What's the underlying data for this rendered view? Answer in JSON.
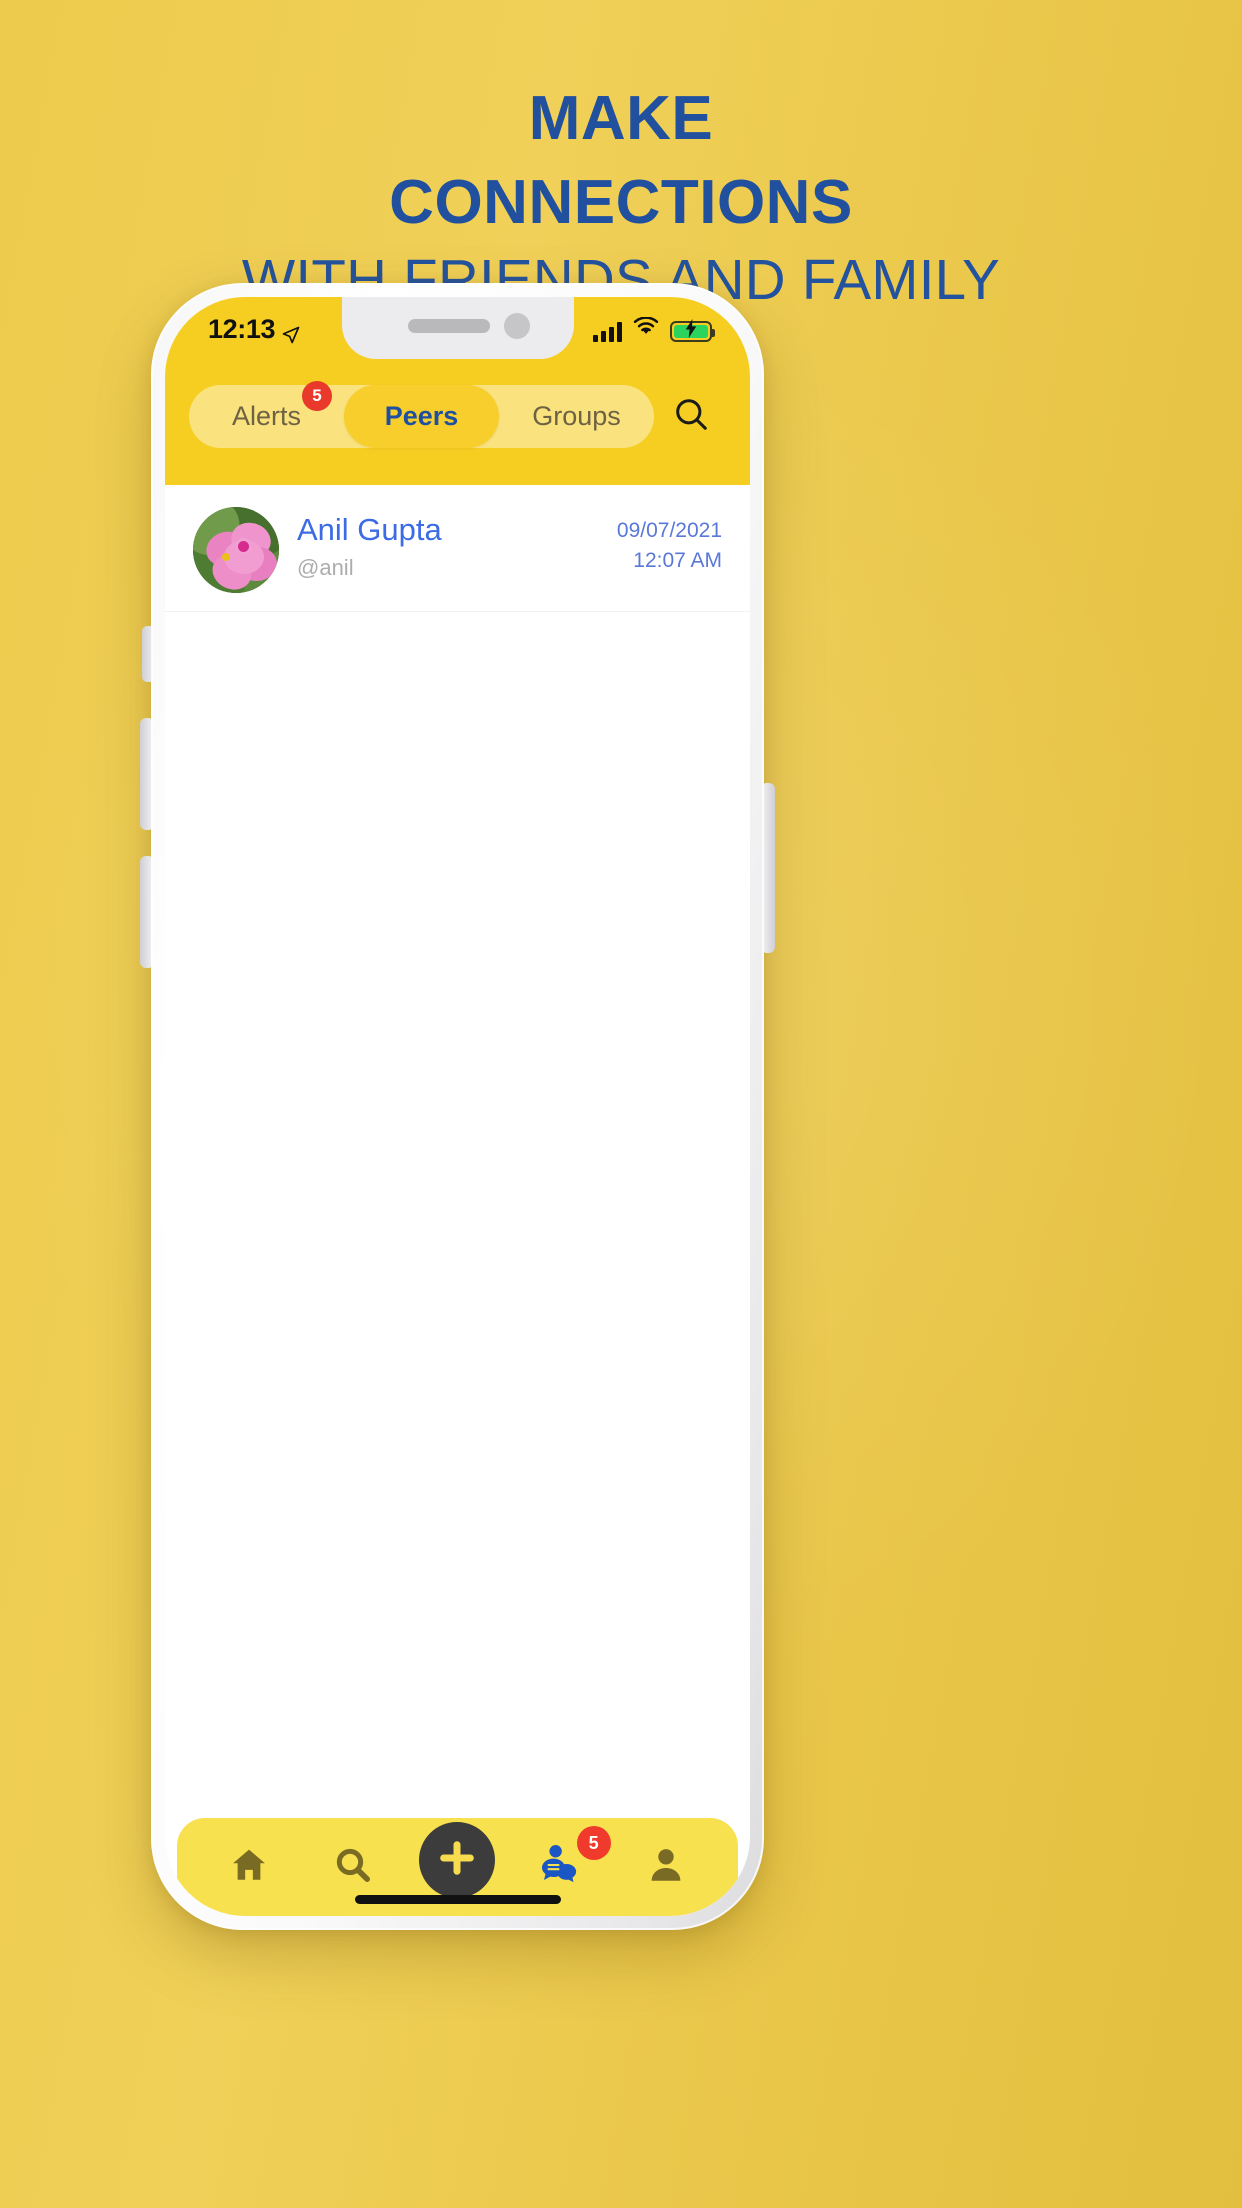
{
  "promo": {
    "line1": "MAKE",
    "line2": "CONNECTIONS",
    "line3": "WITH FRIENDS AND FAMILY",
    "text_color": "#20509E",
    "background_color": "#EFCD4E"
  },
  "phone": {
    "status_bar": {
      "time": "12:13",
      "location_icon": "location-arrow-icon",
      "signal_icon": "cellular-signal-icon",
      "signal_bars": 4,
      "wifi_icon": "wifi-icon",
      "battery_icon": "battery-charging-icon",
      "battery_color": "#2bd45f"
    },
    "header": {
      "background_color": "#F6CE22",
      "tabs": [
        {
          "label": "Alerts",
          "active": false,
          "badge": "5"
        },
        {
          "label": "Peers",
          "active": true,
          "badge": ""
        },
        {
          "label": "Groups",
          "active": false,
          "badge": ""
        }
      ],
      "search_icon": "search-icon",
      "active_tab_color": "#1F4FA0",
      "badge_color": "#E8392B"
    },
    "list": [
      {
        "avatar": "flower-photo-avatar",
        "name": "Anil Gupta",
        "handle": "@anil",
        "date": "09/07/2021",
        "time": "12:07 AM"
      }
    ],
    "bottom_nav": {
      "background_color": "#F8E14F",
      "items": [
        {
          "icon": "home-icon",
          "active": false,
          "badge": ""
        },
        {
          "icon": "search-icon",
          "active": false,
          "badge": ""
        },
        {
          "icon": "plus-icon",
          "active": false,
          "badge": "",
          "fab": true
        },
        {
          "icon": "messages-icon",
          "active": true,
          "badge": "5"
        },
        {
          "icon": "profile-icon",
          "active": false,
          "badge": ""
        }
      ],
      "active_color": "#1A56C4",
      "inactive_color": "#7A6B24",
      "badge_color": "#F03B2C"
    }
  }
}
